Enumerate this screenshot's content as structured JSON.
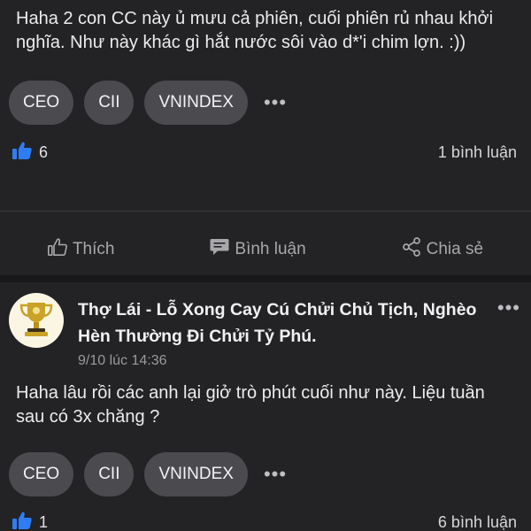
{
  "post1": {
    "text": "Haha 2 con CC này ủ mưu cả phiên, cuối phiên rủ nhau khởi nghĩa. Như này khác gì hắt nước sôi vào d*'i chim lợn. :))",
    "tags": [
      "CEO",
      "CII",
      "VNINDEX"
    ],
    "more": "•••",
    "likes": "6",
    "comments": "1 bình luận"
  },
  "actions": {
    "like": "Thích",
    "comment": "Bình luận",
    "share": "Chia sẻ"
  },
  "post2": {
    "author": "Thợ Lái - Lỗ Xong Cay Cú Chửi Chủ Tịch, Nghèo Hèn Thường Đi Chửi Tỷ Phú.",
    "time": "9/10 lúc 14:36",
    "menu": "•••",
    "text": "Haha lâu rồi các anh lại giở trò phút cuối như này. Liệu tuần sau có 3x chăng ?",
    "tags": [
      "CEO",
      "CII",
      "VNINDEX"
    ],
    "more": "•••",
    "likes": "1",
    "comments": "6 bình luận"
  },
  "colors": {
    "background": "#232325",
    "tag_bg": "#4a4a4f",
    "like_blue": "#2f7df6",
    "muted": "#a8a8ac"
  }
}
